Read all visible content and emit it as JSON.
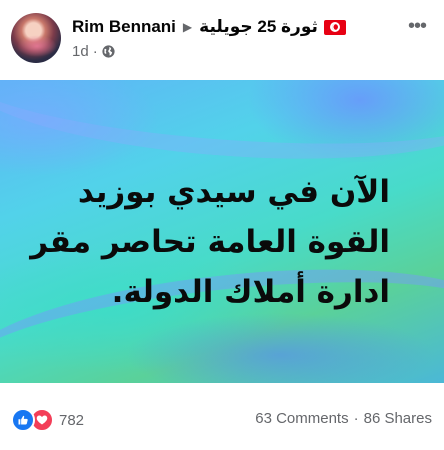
{
  "post": {
    "author": "Rim Bennani",
    "group_name": "ثورة 25 جويلية",
    "time": "1d",
    "meta_separator": "·",
    "more_label": "•••",
    "image_text_lines": [
      "الآن في سيدي بوزيد",
      "القوة العامة تحاصر مقر",
      "ادارة أملاك الدولة."
    ],
    "reactions": {
      "types": [
        "like",
        "love"
      ],
      "count": "782",
      "like_color": "#1877f2",
      "love_color": "#f33e58"
    },
    "comments": "63 Comments",
    "stats_separator": "·",
    "shares": "86 Shares",
    "icons": {
      "privacy": "globe-icon",
      "arrow": "caret-right-icon",
      "flag": "tunisia-flag-icon",
      "more": "more-horizontal-icon"
    }
  }
}
